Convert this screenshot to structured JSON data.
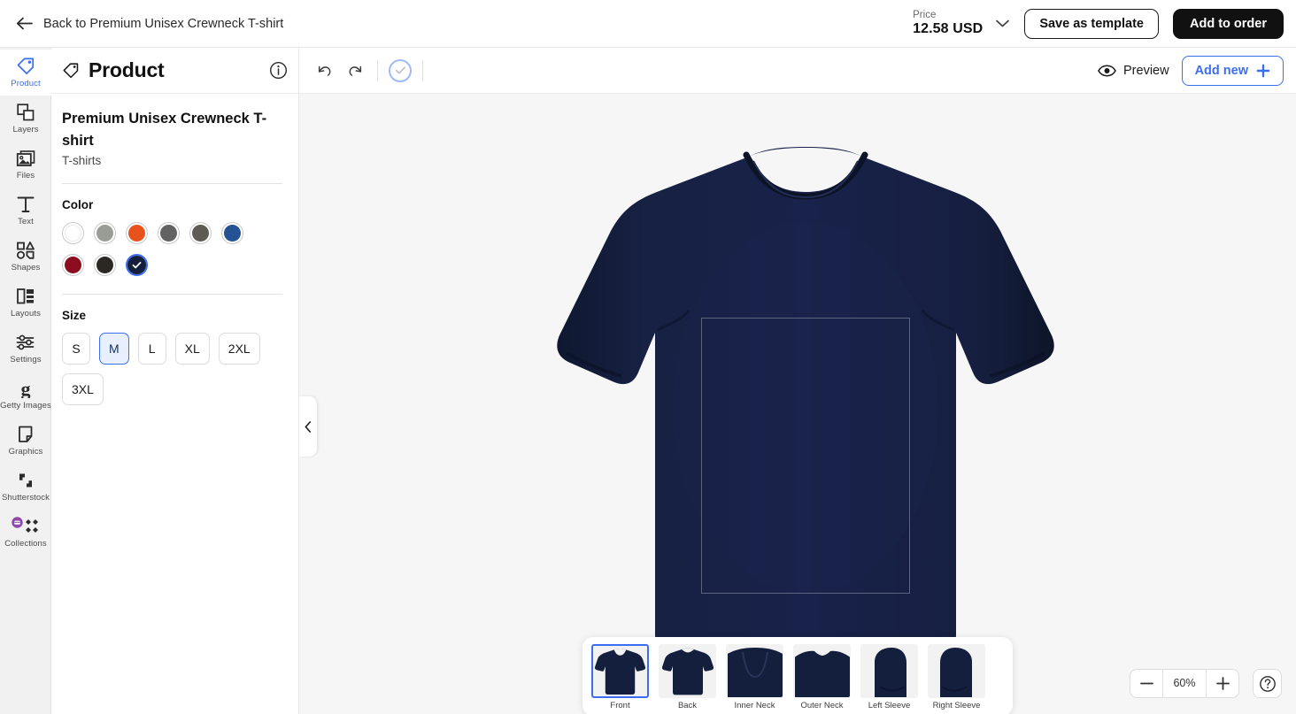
{
  "topbar": {
    "back_label": "Back to Premium Unisex Crewneck T-shirt",
    "back_icon": "arrow-left-icon",
    "price_label": "Price",
    "price_value": "12.58 USD",
    "price_chevron_icon": "chevron-down-icon",
    "save_template_label": "Save as template",
    "add_to_order_label": "Add to order"
  },
  "rail": {
    "items": [
      {
        "label": "Product",
        "icon": "tag-icon",
        "active": true
      },
      {
        "label": "Layers",
        "icon": "layers-icon",
        "active": false
      },
      {
        "label": "Files",
        "icon": "image-file-icon",
        "active": false
      },
      {
        "label": "Text",
        "icon": "text-t-icon",
        "active": false
      },
      {
        "label": "Shapes",
        "icon": "shapes-icon",
        "active": false
      },
      {
        "label": "Layouts",
        "icon": "layouts-icon",
        "active": false
      },
      {
        "label": "Settings",
        "icon": "sliders-icon",
        "active": false
      },
      {
        "label": "Getty Images",
        "icon": "getty-g-icon",
        "active": false
      },
      {
        "label": "Graphics",
        "icon": "sticker-icon",
        "active": false
      },
      {
        "label": "Shutterstock",
        "icon": "shutterstock-icon",
        "active": false
      },
      {
        "label": "Collections",
        "icon": "collections-icon",
        "active": false
      }
    ]
  },
  "panel": {
    "title": "Product",
    "title_icon": "tag-icon",
    "info_icon": "info-circle-icon",
    "product_name": "Premium Unisex Crewneck T-shirt",
    "product_category": "T-shirts",
    "color_section_label": "Color",
    "colors": [
      {
        "name": "White",
        "hex": "#ffffff",
        "selected": false
      },
      {
        "name": "Athletic Heather",
        "hex": "#9a9c96",
        "selected": false
      },
      {
        "name": "Orange",
        "hex": "#e8521c",
        "selected": false
      },
      {
        "name": "Dark Grey Heather",
        "hex": "#626262",
        "selected": false
      },
      {
        "name": "Asphalt",
        "hex": "#5d5b53",
        "selected": false
      },
      {
        "name": "True Royal",
        "hex": "#235394",
        "selected": false
      },
      {
        "name": "Maroon",
        "hex": "#8c0d20",
        "selected": false
      },
      {
        "name": "Black Heather",
        "hex": "#2b2722",
        "selected": false
      },
      {
        "name": "Navy",
        "hex": "#141f3d",
        "selected": true
      }
    ],
    "size_section_label": "Size",
    "sizes": [
      {
        "label": "S",
        "selected": false
      },
      {
        "label": "M",
        "selected": true
      },
      {
        "label": "L",
        "selected": false
      },
      {
        "label": "XL",
        "selected": false
      },
      {
        "label": "2XL",
        "selected": false
      },
      {
        "label": "3XL",
        "selected": false
      }
    ]
  },
  "toolbar": {
    "undo_icon": "undo-icon",
    "redo_icon": "redo-icon",
    "saved_icon": "check-circle-icon",
    "preview_label": "Preview",
    "preview_icon": "eye-icon",
    "add_new_label": "Add new",
    "add_new_icon": "plus-icon"
  },
  "canvas": {
    "collapse_icon": "chevron-left-icon",
    "shirt_color_hex": "#141f3d",
    "background_hex": "#f6f6f6",
    "print_area_border_hex": "#5d657e"
  },
  "thumbnails": [
    {
      "label": "Front",
      "view": "front",
      "selected": true
    },
    {
      "label": "Back",
      "view": "back",
      "selected": false
    },
    {
      "label": "Inner Neck",
      "view": "inner-neck",
      "selected": false
    },
    {
      "label": "Outer Neck",
      "view": "outer-neck",
      "selected": false
    },
    {
      "label": "Left Sleeve",
      "view": "left-sleeve",
      "selected": false
    },
    {
      "label": "Right Sleeve",
      "view": "right-sleeve",
      "selected": false
    }
  ],
  "zoom": {
    "minus_icon": "minus-icon",
    "value": "60%",
    "plus_icon": "plus-icon",
    "help_icon": "question-circle-icon"
  },
  "theme": {
    "accent_blue": "#3b6ef0",
    "dark_button": "#111111",
    "rail_bg": "#f1f1f1"
  }
}
